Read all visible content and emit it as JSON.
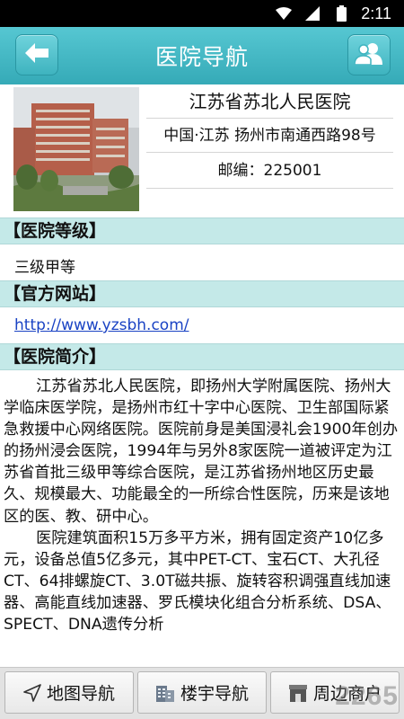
{
  "status_bar": {
    "time": "2:11"
  },
  "header": {
    "title": "医院导航"
  },
  "hospital": {
    "name": "江苏省苏北人民医院",
    "address": "中国·江苏 扬州市南通西路98号",
    "zip": "邮编：225001"
  },
  "sections": {
    "level": {
      "heading": "【医院等级】",
      "value": "三级甲等"
    },
    "website": {
      "heading": "【官方网站】",
      "url": "http://www.yzsbh.com/"
    },
    "intro": {
      "heading": "【医院简介】",
      "paragraphs": [
        "江苏省苏北人民医院，即扬州大学附属医院、扬州大学临床医学院，是扬州市红十字中心医院、卫生部国际紧急救援中心网络医院。医院前身是美国浸礼会1900年创办的扬州浸会医院，1994年与另外8家医院一道被评定为江苏省首批三级甲等综合医院，是江苏省扬州地区历史最久、规模最大、功能最全的一所综合性医院，历来是该地区的医、教、研中心。",
        "医院建筑面积15万多平方米，拥有固定资产10亿多元，设备总值5亿多元，其中PET-CT、宝石CT、大孔径CT、64排螺旋CT、3.0T磁共振、旋转容积调强直线加速器、高能直线加速器、罗氏模块化组合分析系统、DSA、SPECT、DNA遗传分析"
      ]
    }
  },
  "bottom_nav": {
    "map": "地图导航",
    "building": "楼宇导航",
    "nearby": "周边商户"
  },
  "watermark": "2265",
  "icons": {
    "back": "arrow-left-icon",
    "people": "people-icon",
    "navigate": "navigation-arrow-icon",
    "building": "building-icon",
    "shop": "shop-icon"
  },
  "colors": {
    "titlebar": "#3fb5c1",
    "section_bg": "#c4e9e8",
    "link": "#1a43c4"
  }
}
